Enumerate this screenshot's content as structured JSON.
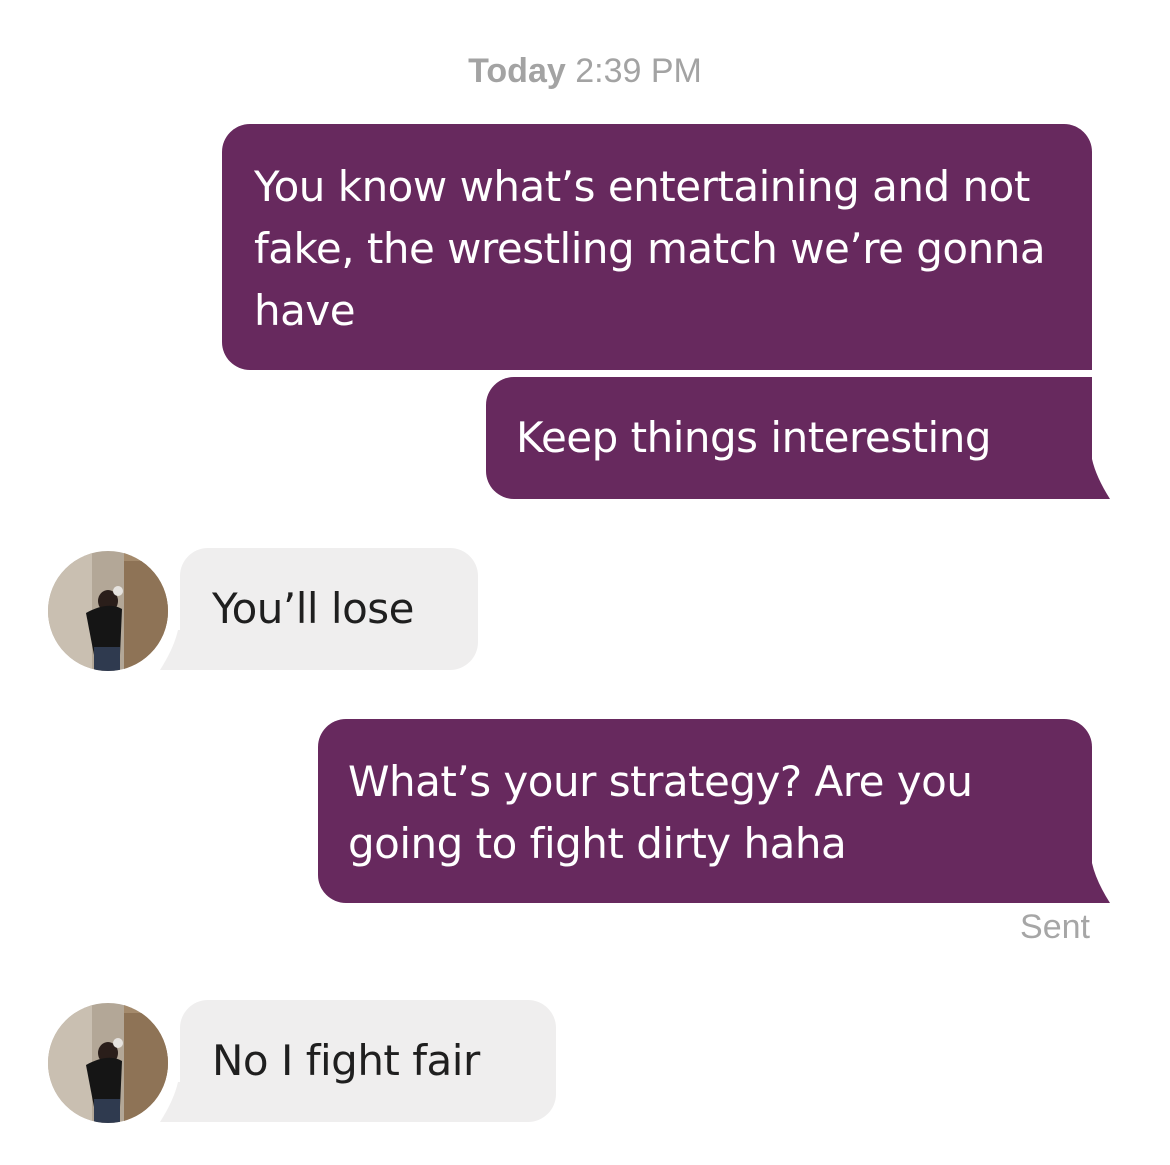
{
  "header": {
    "day_label": "Today",
    "time_label": "2:39 PM"
  },
  "messages": [
    {
      "direction": "sent",
      "text": "You know what’s entertaining and not fake, the wrestling match we’re gonna have"
    },
    {
      "direction": "sent",
      "text": "Keep things interesting"
    },
    {
      "direction": "received",
      "text": "You’ll lose",
      "avatar": "user-photo-avatar"
    },
    {
      "direction": "sent",
      "text": "What’s your strategy? Are you going to fight dirty haha"
    },
    {
      "direction": "received",
      "text": "No I fight fair",
      "avatar": "user-photo-avatar"
    }
  ],
  "status": {
    "sent_label": "Sent"
  },
  "colors": {
    "sent_bubble": "#67295e",
    "received_bubble": "#efeeee",
    "meta_text": "#a3a3a3"
  }
}
